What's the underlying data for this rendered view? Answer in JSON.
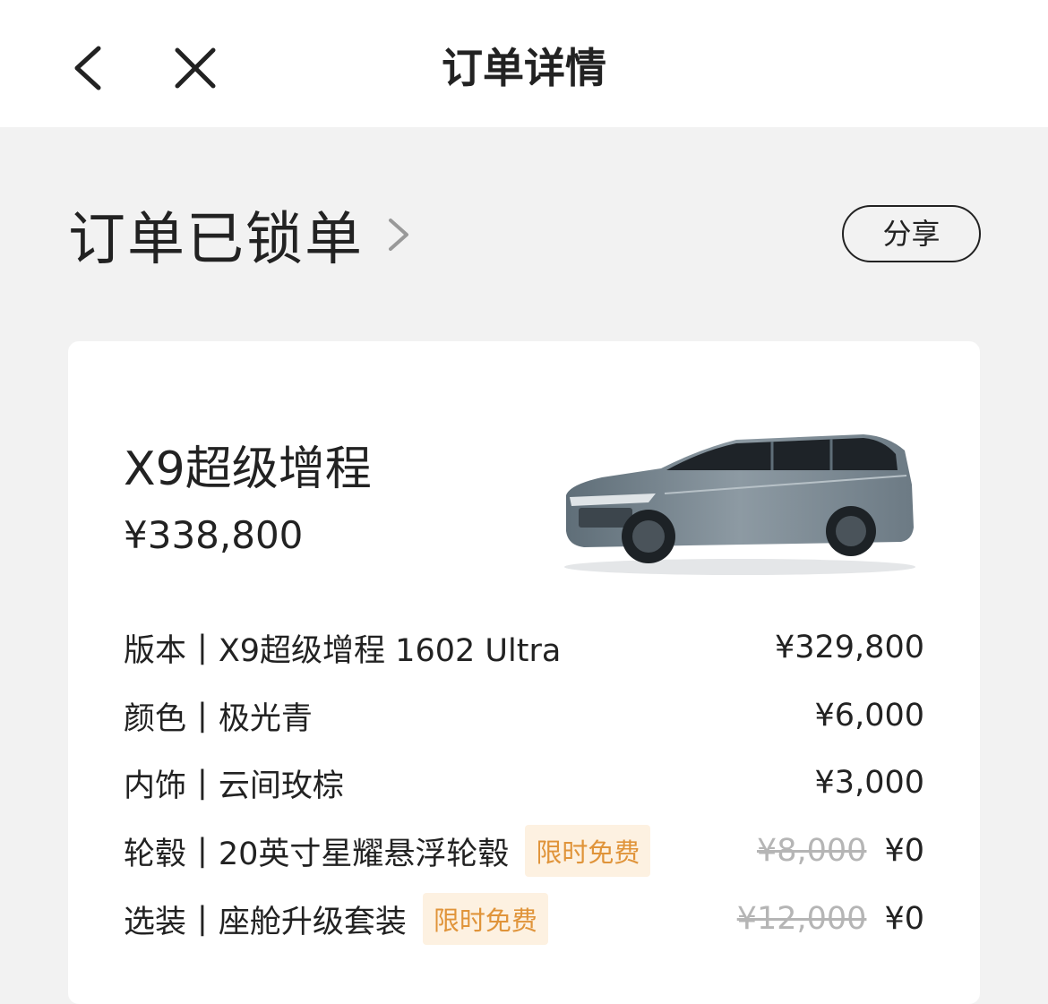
{
  "nav": {
    "title": "订单详情",
    "back_icon": "chevron-left-icon",
    "close_icon": "close-icon"
  },
  "status": {
    "title": "订单已锁单",
    "chevron_icon": "chevron-right-icon",
    "share_label": "分享"
  },
  "order": {
    "model_name": "X9超级增程",
    "model_price": "¥338,800",
    "car_image": "car-mpv-image",
    "items": [
      {
        "label": "版本",
        "separator": "|",
        "value": "X9超级增程 1602 Ultra",
        "badge": "",
        "original_price": "",
        "price": "¥329,800"
      },
      {
        "label": "颜色",
        "separator": "|",
        "value": "极光青",
        "badge": "",
        "original_price": "",
        "price": "¥6,000"
      },
      {
        "label": "内饰",
        "separator": "|",
        "value": "云间玫棕",
        "badge": "",
        "original_price": "",
        "price": "¥3,000"
      },
      {
        "label": "轮毂",
        "separator": "|",
        "value": "20英寸星耀悬浮轮毂",
        "badge": "限时免费",
        "original_price": "¥8,000",
        "price": "¥0"
      },
      {
        "label": "选装",
        "separator": "|",
        "value": "座舱升级套装",
        "badge": "限时免费",
        "original_price": "¥12,000",
        "price": "¥0"
      }
    ]
  },
  "colors": {
    "badge_bg": "#fdf1e1",
    "badge_text": "#e0943a",
    "strike_text": "#b5b5b5",
    "page_bg": "#f2f2f2"
  }
}
